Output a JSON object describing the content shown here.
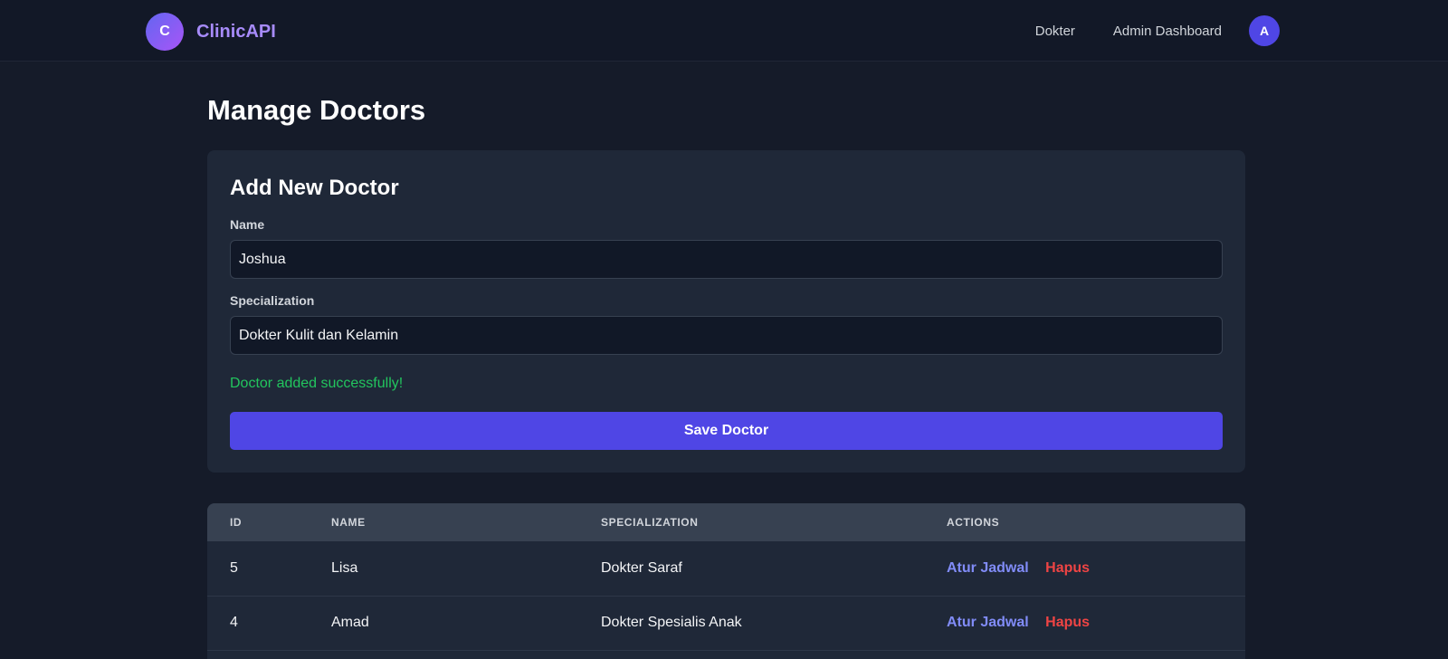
{
  "nav": {
    "logo_letter": "C",
    "brand": "ClinicAPI",
    "links": [
      "Dokter",
      "Admin Dashboard"
    ],
    "avatar_letter": "A"
  },
  "page": {
    "title": "Manage Doctors"
  },
  "form": {
    "title": "Add New Doctor",
    "name_label": "Name",
    "name_value": "Joshua",
    "specialization_label": "Specialization",
    "specialization_value": "Dokter Kulit dan Kelamin",
    "success_message": "Doctor added successfully!",
    "save_label": "Save Doctor"
  },
  "table": {
    "headers": [
      "ID",
      "NAME",
      "SPECIALIZATION",
      "ACTIONS"
    ],
    "rows": [
      {
        "id": "5",
        "name": "Lisa",
        "specialization": "Dokter Saraf",
        "schedule_label": "Atur Jadwal",
        "delete_label": "Hapus"
      },
      {
        "id": "4",
        "name": "Amad",
        "specialization": "Dokter Spesialis Anak",
        "schedule_label": "Atur Jadwal",
        "delete_label": "Hapus"
      }
    ]
  },
  "colors": {
    "accent": "#4f46e5",
    "success": "#22c55e",
    "danger": "#ef4444",
    "link": "#818cf8"
  }
}
